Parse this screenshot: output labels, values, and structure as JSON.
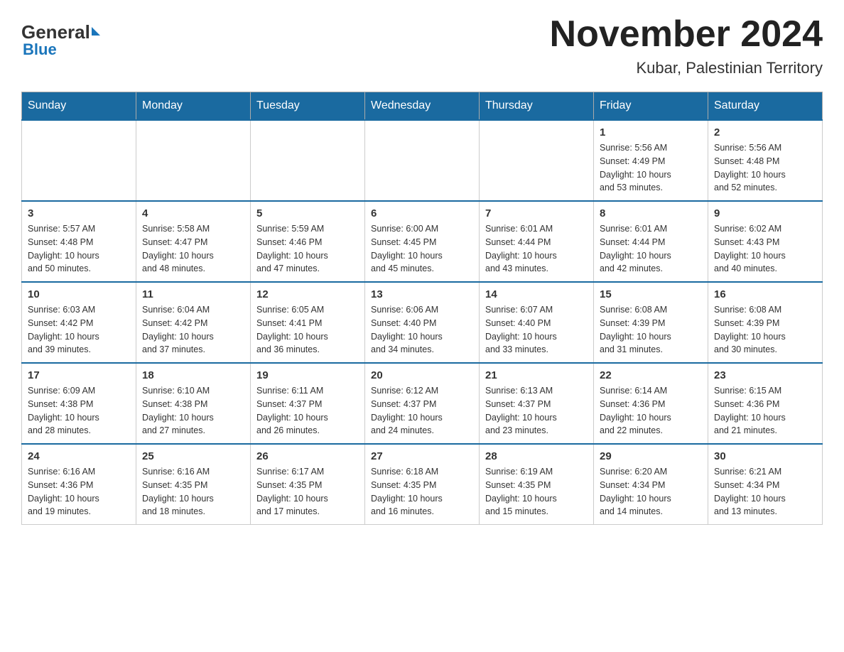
{
  "logo": {
    "text_general": "General",
    "triangle": "▶",
    "text_blue": "Blue"
  },
  "header": {
    "month_title": "November 2024",
    "location": "Kubar, Palestinian Territory"
  },
  "days_of_week": [
    "Sunday",
    "Monday",
    "Tuesday",
    "Wednesday",
    "Thursday",
    "Friday",
    "Saturday"
  ],
  "weeks": [
    {
      "days": [
        {
          "number": "",
          "info": ""
        },
        {
          "number": "",
          "info": ""
        },
        {
          "number": "",
          "info": ""
        },
        {
          "number": "",
          "info": ""
        },
        {
          "number": "",
          "info": ""
        },
        {
          "number": "1",
          "info": "Sunrise: 5:56 AM\nSunset: 4:49 PM\nDaylight: 10 hours\nand 53 minutes."
        },
        {
          "number": "2",
          "info": "Sunrise: 5:56 AM\nSunset: 4:48 PM\nDaylight: 10 hours\nand 52 minutes."
        }
      ]
    },
    {
      "days": [
        {
          "number": "3",
          "info": "Sunrise: 5:57 AM\nSunset: 4:48 PM\nDaylight: 10 hours\nand 50 minutes."
        },
        {
          "number": "4",
          "info": "Sunrise: 5:58 AM\nSunset: 4:47 PM\nDaylight: 10 hours\nand 48 minutes."
        },
        {
          "number": "5",
          "info": "Sunrise: 5:59 AM\nSunset: 4:46 PM\nDaylight: 10 hours\nand 47 minutes."
        },
        {
          "number": "6",
          "info": "Sunrise: 6:00 AM\nSunset: 4:45 PM\nDaylight: 10 hours\nand 45 minutes."
        },
        {
          "number": "7",
          "info": "Sunrise: 6:01 AM\nSunset: 4:44 PM\nDaylight: 10 hours\nand 43 minutes."
        },
        {
          "number": "8",
          "info": "Sunrise: 6:01 AM\nSunset: 4:44 PM\nDaylight: 10 hours\nand 42 minutes."
        },
        {
          "number": "9",
          "info": "Sunrise: 6:02 AM\nSunset: 4:43 PM\nDaylight: 10 hours\nand 40 minutes."
        }
      ]
    },
    {
      "days": [
        {
          "number": "10",
          "info": "Sunrise: 6:03 AM\nSunset: 4:42 PM\nDaylight: 10 hours\nand 39 minutes."
        },
        {
          "number": "11",
          "info": "Sunrise: 6:04 AM\nSunset: 4:42 PM\nDaylight: 10 hours\nand 37 minutes."
        },
        {
          "number": "12",
          "info": "Sunrise: 6:05 AM\nSunset: 4:41 PM\nDaylight: 10 hours\nand 36 minutes."
        },
        {
          "number": "13",
          "info": "Sunrise: 6:06 AM\nSunset: 4:40 PM\nDaylight: 10 hours\nand 34 minutes."
        },
        {
          "number": "14",
          "info": "Sunrise: 6:07 AM\nSunset: 4:40 PM\nDaylight: 10 hours\nand 33 minutes."
        },
        {
          "number": "15",
          "info": "Sunrise: 6:08 AM\nSunset: 4:39 PM\nDaylight: 10 hours\nand 31 minutes."
        },
        {
          "number": "16",
          "info": "Sunrise: 6:08 AM\nSunset: 4:39 PM\nDaylight: 10 hours\nand 30 minutes."
        }
      ]
    },
    {
      "days": [
        {
          "number": "17",
          "info": "Sunrise: 6:09 AM\nSunset: 4:38 PM\nDaylight: 10 hours\nand 28 minutes."
        },
        {
          "number": "18",
          "info": "Sunrise: 6:10 AM\nSunset: 4:38 PM\nDaylight: 10 hours\nand 27 minutes."
        },
        {
          "number": "19",
          "info": "Sunrise: 6:11 AM\nSunset: 4:37 PM\nDaylight: 10 hours\nand 26 minutes."
        },
        {
          "number": "20",
          "info": "Sunrise: 6:12 AM\nSunset: 4:37 PM\nDaylight: 10 hours\nand 24 minutes."
        },
        {
          "number": "21",
          "info": "Sunrise: 6:13 AM\nSunset: 4:37 PM\nDaylight: 10 hours\nand 23 minutes."
        },
        {
          "number": "22",
          "info": "Sunrise: 6:14 AM\nSunset: 4:36 PM\nDaylight: 10 hours\nand 22 minutes."
        },
        {
          "number": "23",
          "info": "Sunrise: 6:15 AM\nSunset: 4:36 PM\nDaylight: 10 hours\nand 21 minutes."
        }
      ]
    },
    {
      "days": [
        {
          "number": "24",
          "info": "Sunrise: 6:16 AM\nSunset: 4:36 PM\nDaylight: 10 hours\nand 19 minutes."
        },
        {
          "number": "25",
          "info": "Sunrise: 6:16 AM\nSunset: 4:35 PM\nDaylight: 10 hours\nand 18 minutes."
        },
        {
          "number": "26",
          "info": "Sunrise: 6:17 AM\nSunset: 4:35 PM\nDaylight: 10 hours\nand 17 minutes."
        },
        {
          "number": "27",
          "info": "Sunrise: 6:18 AM\nSunset: 4:35 PM\nDaylight: 10 hours\nand 16 minutes."
        },
        {
          "number": "28",
          "info": "Sunrise: 6:19 AM\nSunset: 4:35 PM\nDaylight: 10 hours\nand 15 minutes."
        },
        {
          "number": "29",
          "info": "Sunrise: 6:20 AM\nSunset: 4:34 PM\nDaylight: 10 hours\nand 14 minutes."
        },
        {
          "number": "30",
          "info": "Sunrise: 6:21 AM\nSunset: 4:34 PM\nDaylight: 10 hours\nand 13 minutes."
        }
      ]
    }
  ]
}
